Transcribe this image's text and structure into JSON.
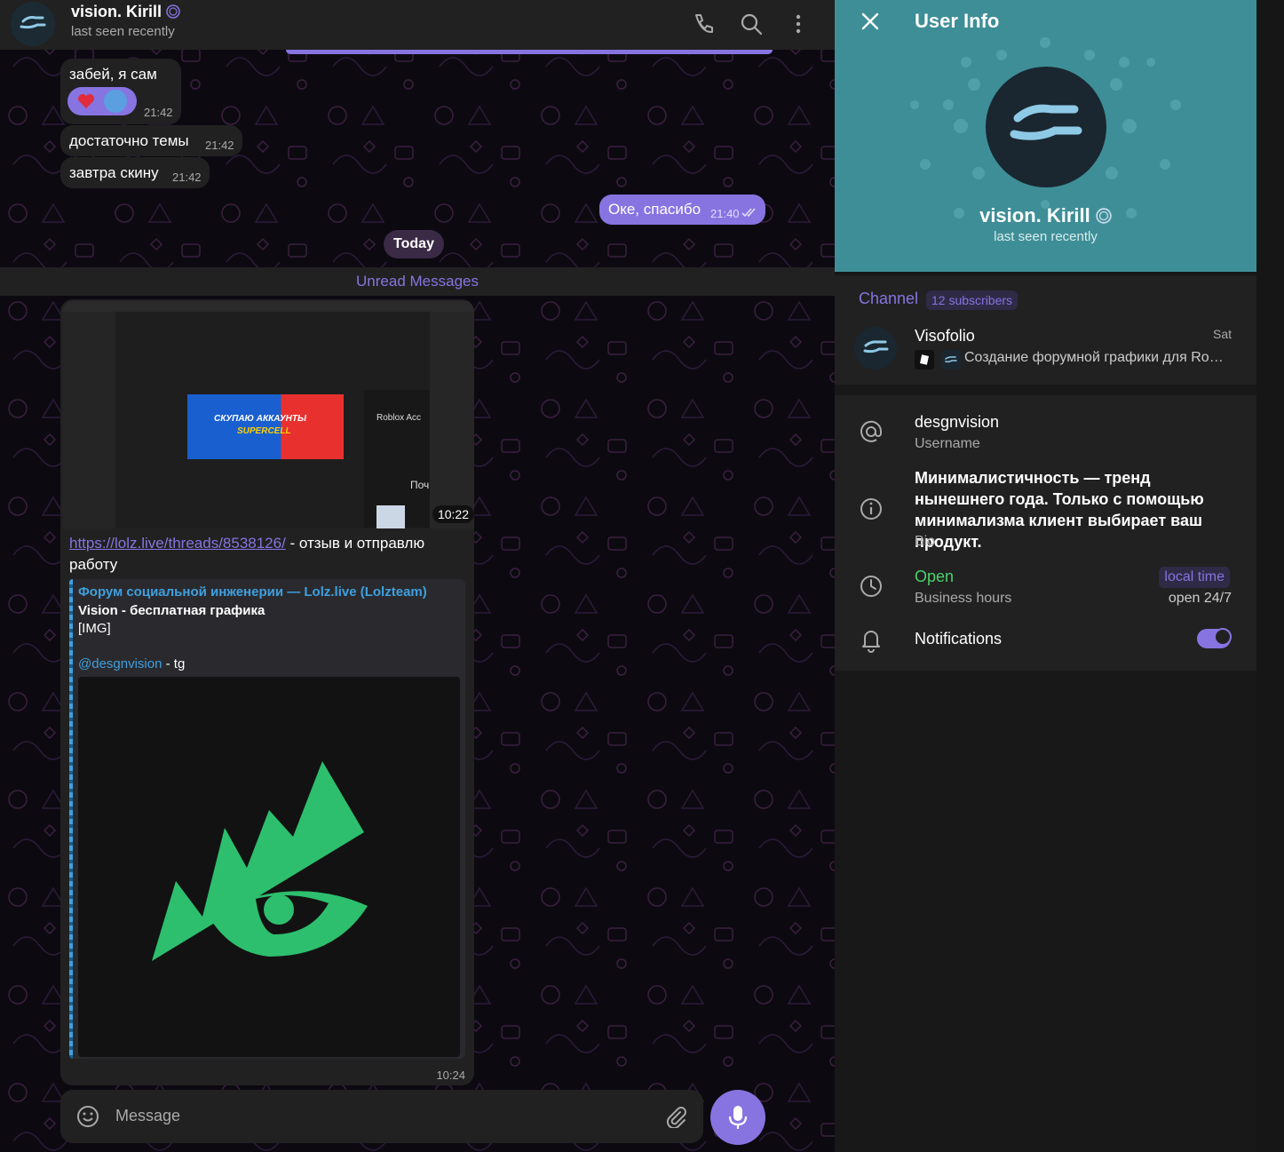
{
  "header": {
    "name": "vision. Kirill",
    "status": "last seen recently"
  },
  "messages": [
    {
      "text": "забей, я сам",
      "time": "21:42"
    },
    {
      "text": "достаточно темы",
      "time": "21:42"
    },
    {
      "text": "завтра скину",
      "time": "21:42"
    },
    {
      "text": "Оке, спасибо",
      "time": "21:40",
      "outgoing": true
    }
  ],
  "date_divider": "Today",
  "unread_label": "Unread Messages",
  "media_message": {
    "video_duration": "10:22",
    "screenshot_banner_line1": "СКУПАЮ АККАУНТЫ",
    "screenshot_banner_line2": "SUPERCELL",
    "screenshot_side_label": "Roblox Acc",
    "screenshot_side_label2": "Поч",
    "link": "https://lolz.live/threads/8538126/",
    "text_after_link": " - отзыв и отправлю работу",
    "preview": {
      "site": "Форум социальной инженерии —  Lolz.live (Lolzteam)",
      "title": "Vision - бесплатная графика",
      "img_tag": "[IMG]",
      "handle": "@desgnvision",
      "handle_suffix": " - tg"
    },
    "time": "10:24"
  },
  "composer": {
    "placeholder": "Message"
  },
  "user_info": {
    "title": "User Info",
    "name": "vision. Kirill",
    "status": "last seen recently",
    "channel_label": "Channel",
    "subscribers": "12 subscribers",
    "channel_name": "Visofolio",
    "channel_date": "Sat",
    "channel_last": "Создание форумной графики для Robl...",
    "username": "desgnvision",
    "username_label": "Username",
    "bio": "Минималистичность — тренд нынешнего года. Только с помощью минимализма клиент выбирает ваш продукт.",
    "bio_label": "Bio",
    "open": "Open",
    "local_time": "local time",
    "business_hours_label": "Business hours",
    "business_hours": "open 24/7",
    "notifications_label": "Notifications",
    "notifications_on": true
  },
  "colors": {
    "accent": "#8774e1",
    "panel_top": "#3e8e97",
    "bubble": "#212121",
    "open_green": "#4bd26b",
    "link_blue": "#3ea0e0",
    "logo_green": "#2dbf6e"
  },
  "icons": [
    "phone-icon",
    "search-icon",
    "more-vertical-icon",
    "close-icon",
    "at-icon",
    "info-icon",
    "clock-icon",
    "bell-icon",
    "emoji-icon",
    "attach-icon",
    "mic-icon",
    "double-check-icon",
    "verified-icon",
    "heart-icon"
  ]
}
